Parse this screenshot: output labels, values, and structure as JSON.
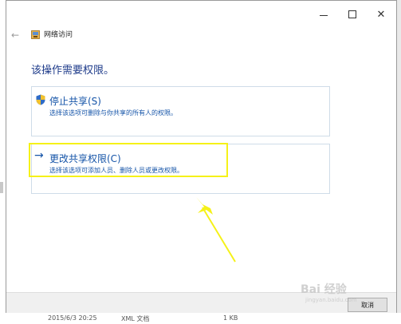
{
  "window": {
    "title": "网络访问",
    "controls": {
      "minimize": "–",
      "maximize": "□",
      "close": "✕"
    },
    "back_glyph": "←"
  },
  "heading": "该操作需要权限。",
  "options": [
    {
      "title": "停止共享(S)",
      "description": "选择该选项可删除与你共享的所有人的权限。",
      "icon": "uac-shield-icon"
    },
    {
      "title": "更改共享权限(C)",
      "description": "选择该选项可添加人员、删除人员或更改权限。",
      "icon": "arrow-right-icon",
      "arrow_glyph": "→",
      "highlighted": true
    }
  ],
  "buttons": {
    "cancel": "取消"
  },
  "annotation": {
    "color": "#f5f118"
  },
  "background_file_row": {
    "date": "2015/6/3 20:25",
    "type": "XML 文档",
    "size": "1 KB"
  },
  "watermark": {
    "text": "Bai 经验",
    "sub": "jingyan.baidu.com"
  },
  "colors": {
    "link_blue": "#1554a8",
    "heading_blue": "#1e3b8a",
    "border": "#cfdce8"
  }
}
